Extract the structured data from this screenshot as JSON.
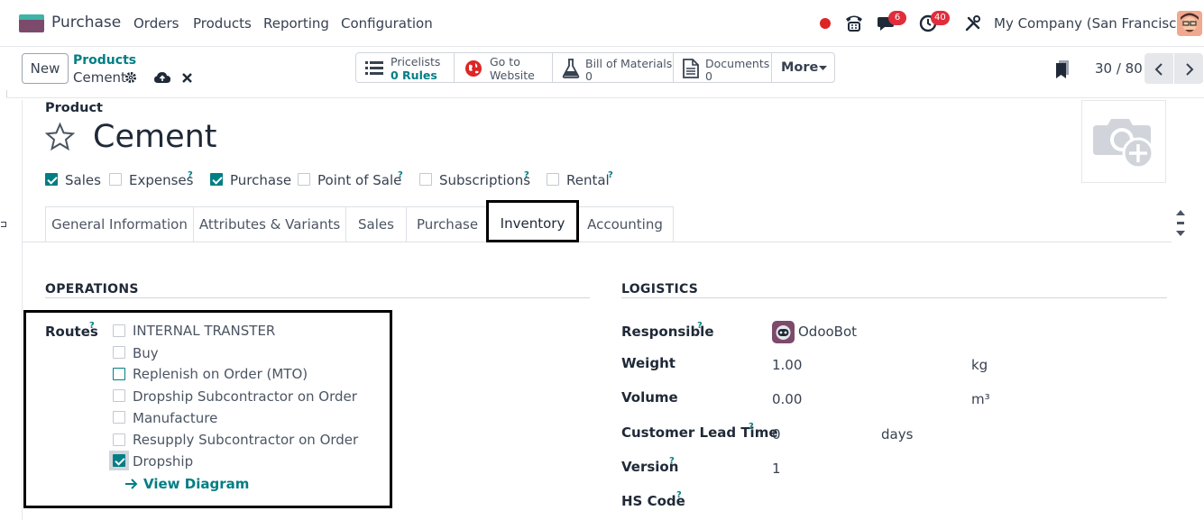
{
  "navbar": {
    "app_name": "Purchase",
    "menu": [
      "Orders",
      "Products",
      "Reporting",
      "Configuration"
    ],
    "messages_badge": "6",
    "activities_badge": "40",
    "company": "My Company (San Francisco)"
  },
  "control_panel": {
    "new_label": "New",
    "breadcrumb_parent": "Products",
    "breadcrumb_current": "Cement",
    "smart_buttons": {
      "pricelists_title": "Pricelists",
      "pricelists_value": "0 Rules",
      "website_line1": "Go to",
      "website_line2": "Website",
      "bom_title": "Bill of Materials",
      "bom_value": "0",
      "documents_title": "Documents",
      "documents_value": "0",
      "more_label": "More"
    },
    "pager": "30 / 80"
  },
  "product": {
    "label": "Product",
    "name": "Cement",
    "flags": [
      {
        "label": "Sales",
        "checked": true
      },
      {
        "label": "Expenses",
        "checked": false,
        "help": "?"
      },
      {
        "label": "Purchase",
        "checked": true
      },
      {
        "label": "Point of Sale",
        "checked": false,
        "help": "?"
      },
      {
        "label": "Subscriptions",
        "checked": false,
        "help": "?"
      },
      {
        "label": "Rental",
        "checked": false,
        "help": "?"
      }
    ]
  },
  "tabs": [
    "General Information",
    "Attributes & Variants",
    "Sales",
    "Purchase",
    "Inventory",
    "Accounting"
  ],
  "active_tab": "Inventory",
  "operations": {
    "title": "OPERATIONS",
    "routes_label": "Routes",
    "routes": [
      {
        "label": "INTERNAL TRANSTER",
        "checked": false
      },
      {
        "label": "Buy",
        "checked": false
      },
      {
        "label": "Replenish on Order (MTO)",
        "checked": false
      },
      {
        "label": "Dropship Subcontractor on Order",
        "checked": false
      },
      {
        "label": "Manufacture",
        "checked": false
      },
      {
        "label": "Resupply Subcontractor on Order",
        "checked": false
      },
      {
        "label": "Dropship",
        "checked": true
      }
    ],
    "view_diagram": "View Diagram"
  },
  "logistics": {
    "title": "LOGISTICS",
    "responsible_label": "Responsible",
    "responsible_value": "OdooBot",
    "weight_label": "Weight",
    "weight_value": "1.00",
    "weight_unit": "kg",
    "volume_label": "Volume",
    "volume_value": "0.00",
    "volume_unit": "m³",
    "lead_time_label": "Customer Lead Time",
    "lead_time_value": "0",
    "lead_time_unit": "days",
    "version_label": "Version",
    "version_value": "1",
    "hs_code_label": "HS Code"
  },
  "colors": {
    "accent": "#017e84",
    "brand_purple": "#7c4a6a",
    "badge_red": "#e02d3c"
  }
}
